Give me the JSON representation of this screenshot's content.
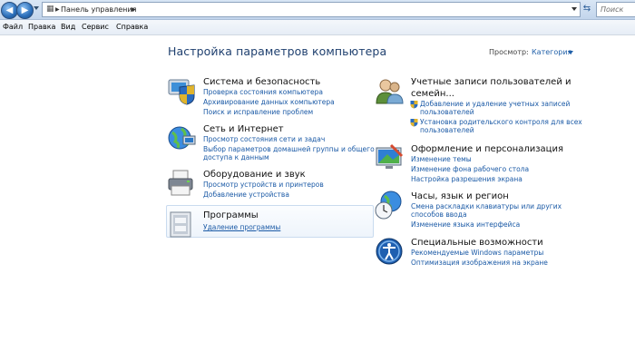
{
  "address_bar": {
    "path": "Панель управления",
    "search_placeholder": "Поиск"
  },
  "menu": [
    "Файл",
    "Правка",
    "Вид",
    "Сервис",
    "Справка"
  ],
  "page": {
    "title": "Настройка параметров компьютера",
    "view_label": "Просмотр:",
    "view_value": "Категория"
  },
  "categories": {
    "system": {
      "heading": "Система и безопасность",
      "links": [
        "Проверка состояния компьютера",
        "Архивирование данных компьютера",
        "Поиск и исправление проблем"
      ]
    },
    "network": {
      "heading": "Сеть и Интернет",
      "links": [
        "Просмотр состояния сети и задач",
        "Выбор параметров домашней группы и общего",
        "доступа к данным"
      ]
    },
    "hardware": {
      "heading": "Оборудование и звук",
      "links": [
        "Просмотр устройств и принтеров",
        "Добавление устройства"
      ]
    },
    "programs": {
      "heading": "Программы",
      "links": [
        "Удаление программы"
      ]
    },
    "accounts": {
      "heading": [
        "Учетные записи пользователей и",
        "семейн..."
      ],
      "links": [
        "Добавление и удаление учетных записей",
        "пользователей",
        "Установка родительского контроля для всех",
        "пользователей"
      ]
    },
    "appearance": {
      "heading": "Оформление и персонализация",
      "links": [
        "Изменение темы",
        "Изменение фона рабочего стола",
        "Настройка разрешения экрана"
      ]
    },
    "clock": {
      "heading": "Часы, язык и регион",
      "links": [
        "Смена раскладки клавиатуры или других",
        "способов ввода",
        "Изменение языка интерфейса"
      ]
    },
    "ease": {
      "heading": "Специальные возможности",
      "links": [
        "Рекомендуемые Windows параметры",
        "Оптимизация изображения на экране"
      ]
    }
  },
  "colors": {
    "title": "#1e3f6e",
    "link": "#1b5aa6",
    "titlebar": "#c2d5ec"
  }
}
